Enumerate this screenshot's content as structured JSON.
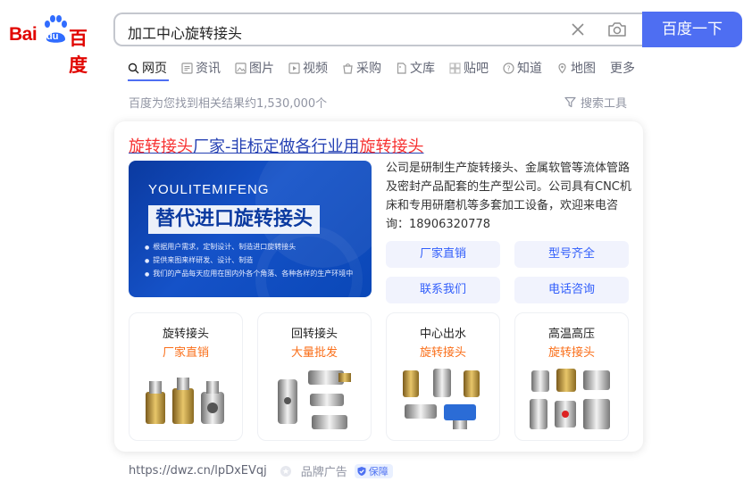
{
  "logo": {
    "part1": "Bai",
    "part2": "du",
    "part3": "百度"
  },
  "search": {
    "query": "加工中心旋转接头",
    "button_label": "百度一下"
  },
  "tabs": [
    {
      "label": "网页",
      "icon": "search-icon",
      "active": true
    },
    {
      "label": "资讯",
      "icon": "news-icon"
    },
    {
      "label": "图片",
      "icon": "image-icon"
    },
    {
      "label": "视频",
      "icon": "video-icon"
    },
    {
      "label": "采购",
      "icon": "shopping-icon"
    },
    {
      "label": "文库",
      "icon": "document-icon"
    },
    {
      "label": "贴吧",
      "icon": "forum-icon"
    },
    {
      "label": "知道",
      "icon": "question-icon"
    },
    {
      "label": "地图",
      "icon": "map-icon"
    },
    {
      "label": "更多",
      "icon": ""
    }
  ],
  "result_count": "百度为您找到相关结果约1,530,000个",
  "tools_label": "搜索工具",
  "ad": {
    "title_hl1": "旋转接头",
    "title_mid": "厂家-非标定做各行业用",
    "title_hl2": "旋转接头",
    "banner": {
      "brand": "YOULITEMIFENG",
      "heading": "替代进口旋转接头",
      "bullets": [
        "根据用户需求，定制设计、制造进口旋转接头",
        "提供来图来样研发、设计、制造",
        "我们的产品每天应用在国内外各个角落、各种各样的生产环境中"
      ]
    },
    "description": "公司是研制生产旋转接头、金属软管等流体管路及密封产品配套的生产型公司。公司具有CNC机床和专用研磨机等多套加工设备，欢迎来电咨询：18906320778",
    "links": [
      "厂家直销",
      "型号齐全",
      "联系我们",
      "电话咨询"
    ],
    "products": [
      {
        "name": "旋转接头",
        "tag": "厂家直销"
      },
      {
        "name": "回转接头",
        "tag": "大量批发"
      },
      {
        "name": "中心出水",
        "tag": "旋转接头"
      },
      {
        "name": "高温高压",
        "tag": "旋转接头"
      }
    ],
    "footer": {
      "url": "https://dwz.cn/lpDxEVqj",
      "ad_label": "品牌广告",
      "badge": "保障"
    }
  },
  "colors": {
    "brand_red": "#e10601",
    "brand_blue": "#4e6ef2",
    "link_blue": "#2440b3",
    "highlight_red": "#f73131",
    "tag_orange": "#fa6f1a"
  }
}
